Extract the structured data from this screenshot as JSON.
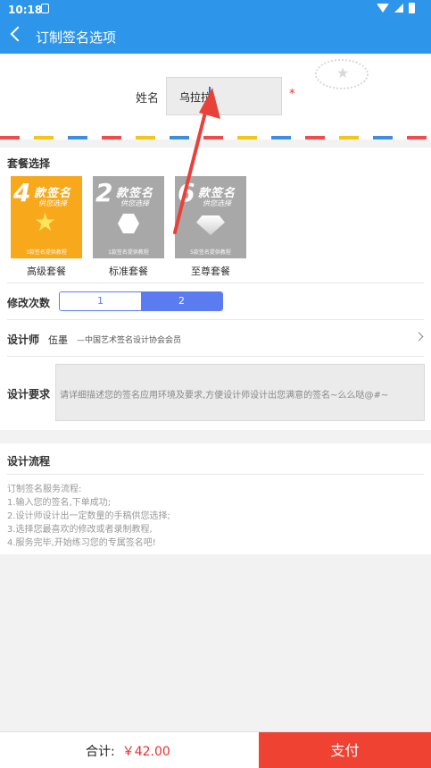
{
  "status": {
    "time": "10:18"
  },
  "appbar": {
    "title": "订制签名选项"
  },
  "name_field": {
    "label": "姓名",
    "value": "乌拉拉",
    "required_mark": "*"
  },
  "packages": {
    "title": "套餐选择",
    "items": [
      {
        "number": "4",
        "line1": "款签名",
        "line2": "供您选择",
        "footer": "3款签名提供教程",
        "label": "高级套餐",
        "color": "#f7a81b",
        "icon": "star-icon"
      },
      {
        "number": "2",
        "line1": "款签名",
        "line2": "供您选择",
        "footer": "1款签名提供教程",
        "label": "标准套餐",
        "color": "#a8a8a8",
        "icon": "hexagon-icon"
      },
      {
        "number": "6",
        "line1": "款签名",
        "line2": "供您选择",
        "footer": "5款签名提供教程",
        "label": "至尊套餐",
        "color": "#a8a8a8",
        "icon": "diamond-icon"
      }
    ]
  },
  "revisions": {
    "label": "修改次数",
    "options": [
      "1",
      "2"
    ],
    "selected": "2"
  },
  "designer": {
    "label": "设计师",
    "name": "伍墨",
    "title": "—中国艺术签名设计协会会员"
  },
  "requirements": {
    "label": "设计要求",
    "placeholder": "请详细描述您的签名应用环境及要求,方便设计师设计出您满意的签名~么么哒@#~"
  },
  "process": {
    "title": "设计流程",
    "lines": [
      "订制签名服务流程:",
      "1.输入您的签名,下单成功;",
      "2.设计师设计出一定数量的手稿供您选择;",
      "3.选择您最喜欢的修改或者录制教程,",
      "4.服务完毕,开始练习您的专属签名吧!"
    ]
  },
  "bottom": {
    "total_label": "合计:",
    "total_amount": "￥42.00",
    "pay_label": "支付"
  },
  "colors": {
    "primary": "#2e96ea",
    "accent": "#5b7bf0",
    "pay": "#f04233",
    "price": "#f02d2d",
    "annotation": "#e8413a"
  }
}
